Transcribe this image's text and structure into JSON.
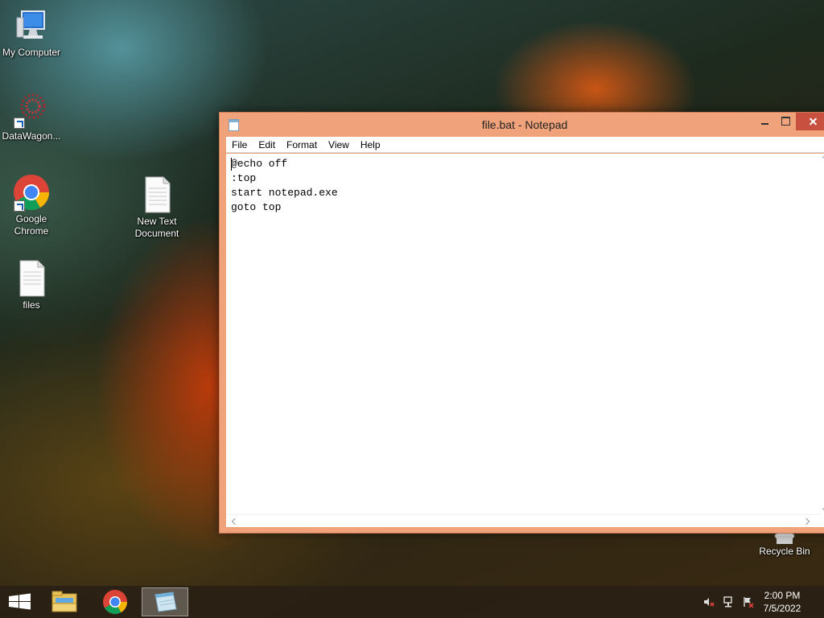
{
  "desktop": {
    "icons": [
      {
        "label": "My Computer",
        "icon": "computer-icon"
      },
      {
        "label": "DataWagon...",
        "icon": "datawagon-icon"
      },
      {
        "label": "Google Chrome",
        "icon": "chrome-icon"
      },
      {
        "label": "New Text Document",
        "icon": "text-document-icon"
      },
      {
        "label": "files",
        "icon": "text-document-icon"
      },
      {
        "label": "Recycle Bin",
        "icon": "recycle-bin-icon"
      }
    ]
  },
  "notepad": {
    "title": "file.bat - Notepad",
    "menu": [
      "File",
      "Edit",
      "Format",
      "View",
      "Help"
    ],
    "content": "@echo off\n:top\nstart notepad.exe\ngoto top"
  },
  "taskbar": {
    "time": "2:00 PM",
    "date": "7/5/2022",
    "pinned": [
      "start-icon",
      "file-explorer-icon",
      "chrome-icon",
      "notepad-icon"
    ],
    "tray": [
      "volume-muted-icon",
      "network-icon",
      "action-center-icon"
    ]
  },
  "colors": {
    "window_frame": "#f0a37a",
    "close_button": "#c7503f"
  }
}
